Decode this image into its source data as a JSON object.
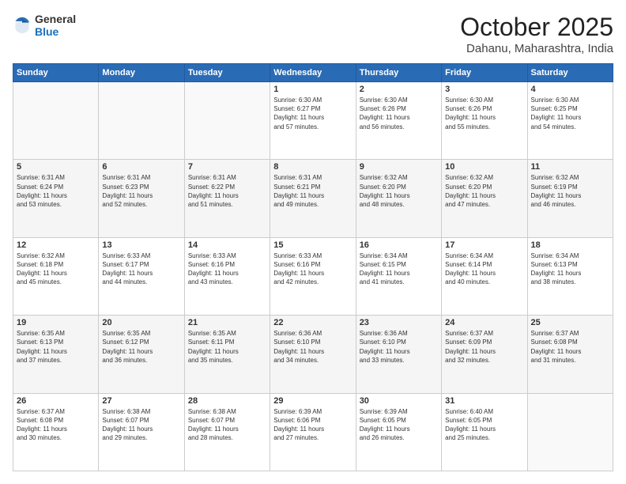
{
  "header": {
    "logo": {
      "general": "General",
      "blue": "Blue"
    },
    "title": "October 2025",
    "location": "Dahanu, Maharashtra, India"
  },
  "weekdays": [
    "Sunday",
    "Monday",
    "Tuesday",
    "Wednesday",
    "Thursday",
    "Friday",
    "Saturday"
  ],
  "weeks": [
    [
      {
        "day": "",
        "info": ""
      },
      {
        "day": "",
        "info": ""
      },
      {
        "day": "",
        "info": ""
      },
      {
        "day": "1",
        "info": "Sunrise: 6:30 AM\nSunset: 6:27 PM\nDaylight: 11 hours\nand 57 minutes."
      },
      {
        "day": "2",
        "info": "Sunrise: 6:30 AM\nSunset: 6:26 PM\nDaylight: 11 hours\nand 56 minutes."
      },
      {
        "day": "3",
        "info": "Sunrise: 6:30 AM\nSunset: 6:26 PM\nDaylight: 11 hours\nand 55 minutes."
      },
      {
        "day": "4",
        "info": "Sunrise: 6:30 AM\nSunset: 6:25 PM\nDaylight: 11 hours\nand 54 minutes."
      }
    ],
    [
      {
        "day": "5",
        "info": "Sunrise: 6:31 AM\nSunset: 6:24 PM\nDaylight: 11 hours\nand 53 minutes."
      },
      {
        "day": "6",
        "info": "Sunrise: 6:31 AM\nSunset: 6:23 PM\nDaylight: 11 hours\nand 52 minutes."
      },
      {
        "day": "7",
        "info": "Sunrise: 6:31 AM\nSunset: 6:22 PM\nDaylight: 11 hours\nand 51 minutes."
      },
      {
        "day": "8",
        "info": "Sunrise: 6:31 AM\nSunset: 6:21 PM\nDaylight: 11 hours\nand 49 minutes."
      },
      {
        "day": "9",
        "info": "Sunrise: 6:32 AM\nSunset: 6:20 PM\nDaylight: 11 hours\nand 48 minutes."
      },
      {
        "day": "10",
        "info": "Sunrise: 6:32 AM\nSunset: 6:20 PM\nDaylight: 11 hours\nand 47 minutes."
      },
      {
        "day": "11",
        "info": "Sunrise: 6:32 AM\nSunset: 6:19 PM\nDaylight: 11 hours\nand 46 minutes."
      }
    ],
    [
      {
        "day": "12",
        "info": "Sunrise: 6:32 AM\nSunset: 6:18 PM\nDaylight: 11 hours\nand 45 minutes."
      },
      {
        "day": "13",
        "info": "Sunrise: 6:33 AM\nSunset: 6:17 PM\nDaylight: 11 hours\nand 44 minutes."
      },
      {
        "day": "14",
        "info": "Sunrise: 6:33 AM\nSunset: 6:16 PM\nDaylight: 11 hours\nand 43 minutes."
      },
      {
        "day": "15",
        "info": "Sunrise: 6:33 AM\nSunset: 6:16 PM\nDaylight: 11 hours\nand 42 minutes."
      },
      {
        "day": "16",
        "info": "Sunrise: 6:34 AM\nSunset: 6:15 PM\nDaylight: 11 hours\nand 41 minutes."
      },
      {
        "day": "17",
        "info": "Sunrise: 6:34 AM\nSunset: 6:14 PM\nDaylight: 11 hours\nand 40 minutes."
      },
      {
        "day": "18",
        "info": "Sunrise: 6:34 AM\nSunset: 6:13 PM\nDaylight: 11 hours\nand 38 minutes."
      }
    ],
    [
      {
        "day": "19",
        "info": "Sunrise: 6:35 AM\nSunset: 6:13 PM\nDaylight: 11 hours\nand 37 minutes."
      },
      {
        "day": "20",
        "info": "Sunrise: 6:35 AM\nSunset: 6:12 PM\nDaylight: 11 hours\nand 36 minutes."
      },
      {
        "day": "21",
        "info": "Sunrise: 6:35 AM\nSunset: 6:11 PM\nDaylight: 11 hours\nand 35 minutes."
      },
      {
        "day": "22",
        "info": "Sunrise: 6:36 AM\nSunset: 6:10 PM\nDaylight: 11 hours\nand 34 minutes."
      },
      {
        "day": "23",
        "info": "Sunrise: 6:36 AM\nSunset: 6:10 PM\nDaylight: 11 hours\nand 33 minutes."
      },
      {
        "day": "24",
        "info": "Sunrise: 6:37 AM\nSunset: 6:09 PM\nDaylight: 11 hours\nand 32 minutes."
      },
      {
        "day": "25",
        "info": "Sunrise: 6:37 AM\nSunset: 6:08 PM\nDaylight: 11 hours\nand 31 minutes."
      }
    ],
    [
      {
        "day": "26",
        "info": "Sunrise: 6:37 AM\nSunset: 6:08 PM\nDaylight: 11 hours\nand 30 minutes."
      },
      {
        "day": "27",
        "info": "Sunrise: 6:38 AM\nSunset: 6:07 PM\nDaylight: 11 hours\nand 29 minutes."
      },
      {
        "day": "28",
        "info": "Sunrise: 6:38 AM\nSunset: 6:07 PM\nDaylight: 11 hours\nand 28 minutes."
      },
      {
        "day": "29",
        "info": "Sunrise: 6:39 AM\nSunset: 6:06 PM\nDaylight: 11 hours\nand 27 minutes."
      },
      {
        "day": "30",
        "info": "Sunrise: 6:39 AM\nSunset: 6:05 PM\nDaylight: 11 hours\nand 26 minutes."
      },
      {
        "day": "31",
        "info": "Sunrise: 6:40 AM\nSunset: 6:05 PM\nDaylight: 11 hours\nand 25 minutes."
      },
      {
        "day": "",
        "info": ""
      }
    ]
  ]
}
